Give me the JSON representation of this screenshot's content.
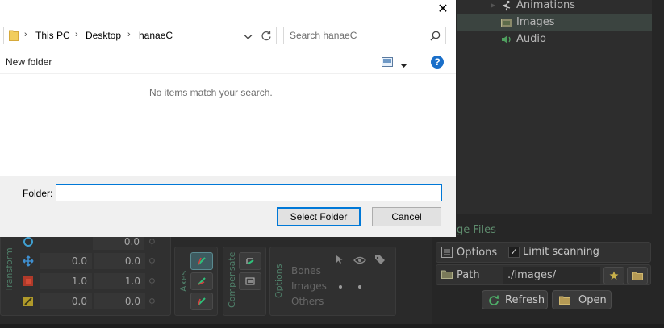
{
  "dialog": {
    "close_glyph": "✕",
    "breadcrumb": [
      "This PC",
      "Desktop",
      "hanaeC"
    ],
    "search_placeholder": "Search hanaeC",
    "new_folder": "New folder",
    "help_glyph": "?",
    "empty_message": "No items match your search.",
    "folder_label": "Folder:",
    "folder_value": "",
    "select_button": "Select Folder",
    "cancel_button": "Cancel"
  },
  "tree": {
    "items": [
      {
        "label": "Animations",
        "icon": "run-icon"
      },
      {
        "label": "Images",
        "icon": "folder-icon",
        "selected": true
      },
      {
        "label": "Audio",
        "icon": "speaker-icon"
      }
    ]
  },
  "images_panel": {
    "title": "ge Files",
    "options_label": "Options",
    "limit_scanning_label": "Limit scanning",
    "limit_scanning_checked": true,
    "path_label": "Path",
    "path_value": "./images/",
    "refresh_button": "Refresh",
    "open_button": "Open"
  },
  "tools": {
    "transform_label": "Transform",
    "rows": [
      {
        "x": "",
        "y": "0.0"
      },
      {
        "x": "0.0",
        "y": "0.0"
      },
      {
        "x": "1.0",
        "y": "1.0"
      },
      {
        "x": "0.0",
        "y": "0.0"
      }
    ],
    "axes_label": "Axes",
    "compensate_label": "Compensate",
    "options_label": "Options",
    "options_rows": [
      "Bones",
      "Images",
      "Others"
    ]
  },
  "colors": {
    "accent_blue": "#0078d7",
    "spine_green": "#5e8b6d",
    "help_blue": "#1a6fc9"
  }
}
